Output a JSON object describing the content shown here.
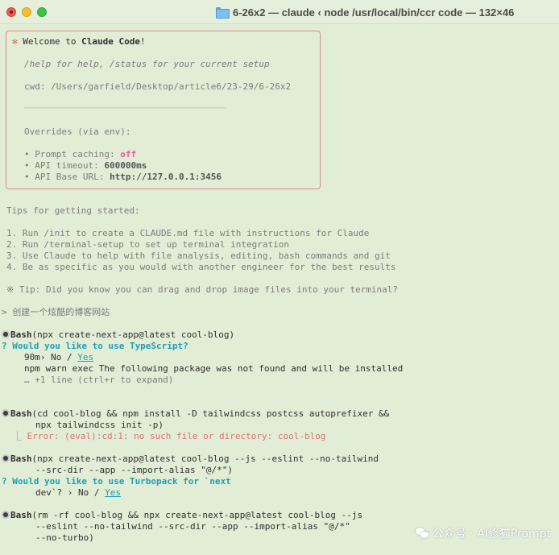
{
  "window": {
    "title": "6-26x2 — claude ‹ node /usr/local/bin/ccr code — 132×46"
  },
  "welcome": {
    "star": "✻",
    "prefix": "Welcome to ",
    "app_name": "Claude Code",
    "suffix": "!",
    "help": "/help for help, /status for your current setup",
    "cwd": "cwd: /Users/garfield/Desktop/article6/23-29/6-26x2",
    "separator": "────────────────────────────────────────────────────",
    "overrides_title": "Overrides (via env):",
    "overrides": [
      {
        "label": "• Prompt caching: ",
        "value": "off"
      },
      {
        "label": "• API timeout: ",
        "value": "600000ms"
      },
      {
        "label": "• API Base URL: ",
        "value": "http://127.0.0.1:3456"
      }
    ]
  },
  "tips": {
    "title": "Tips for getting started:",
    "items": [
      "1. Run /init to create a CLAUDE.md file with instructions for Claude",
      "2. Run /terminal-setup to set up terminal integration",
      "3. Use Claude to help with file analysis, editing, bash commands and git",
      "4. Be as specific as you would with another engineer for the best results"
    ],
    "extra_tip": "※ Tip: Did you know you can drag and drop image files into your terminal?"
  },
  "prompt": {
    "marker": "> ",
    "text": "创建一个炫酷的博客网站"
  },
  "session": {
    "bash1": {
      "label": "Bash",
      "command": "(npx create-next-app@latest cool-blog)",
      "question": "? Would you like to use TypeScript?",
      "answer_prefix": "90m› No / ",
      "answer_yes": "Yes",
      "output": "npm warn exec The following package was not found and will be installed",
      "more": "… +1 line (ctrl+r to expand)"
    },
    "bash2": {
      "label": "Bash",
      "command_l1": "(cd cool-blog && npm install -D tailwindcss postcss autoprefixer &&",
      "command_l2": "npx tailwindcss init -p)",
      "error_marker": "⎿ ",
      "error": "Error: (eval):cd:1: no such file or directory: cool-blog"
    },
    "bash3": {
      "label": "Bash",
      "command_l1": "(npx create-next-app@latest cool-blog --js --eslint --no-tailwind",
      "command_l2": "--src-dir --app --import-alias \"@/*\")",
      "question": "? Would you like to use Turbopack for `next",
      "answer_prefix": "dev`? › No / ",
      "answer_yes": "Yes"
    },
    "bash4": {
      "label": "Bash",
      "command_l1": "(rm -rf cool-blog && npx create-next-app@latest cool-blog --js",
      "command_l2": "--eslint --no-tailwind --src-dir --app --import-alias \"@/*\"",
      "command_l3": "--no-turbo)"
    }
  },
  "watermark": {
    "text": "公众号 · AI修猫Prompt"
  },
  "colors": {
    "background": "#e2edd6",
    "box_border": "#d98a8a",
    "accent_pink": "#e85b9a",
    "accent_cyan": "#1d9fb5",
    "error_red": "#e07070"
  }
}
